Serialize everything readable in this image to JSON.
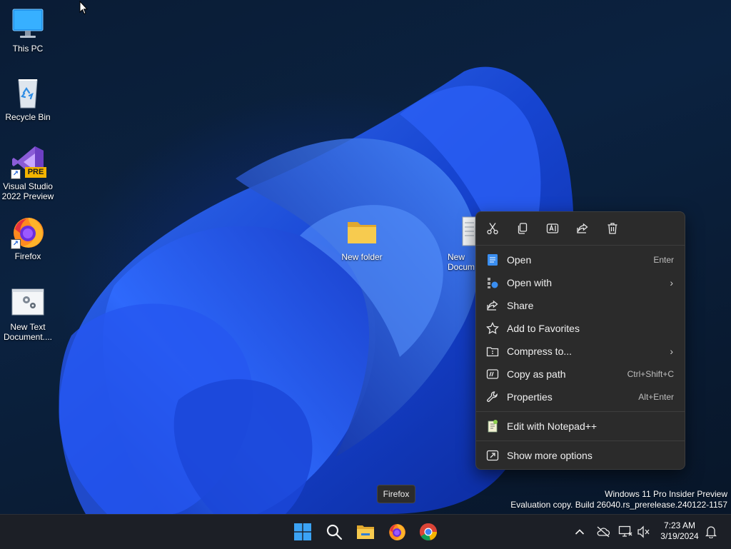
{
  "desktop": {
    "icons": [
      {
        "label": "This PC"
      },
      {
        "label": "Recycle Bin"
      },
      {
        "label": "Visual Studio 2022 Preview",
        "badge": "PRE"
      },
      {
        "label": "Firefox"
      },
      {
        "label": "New Text Document...."
      },
      {
        "label": "New folder"
      },
      {
        "label": "New Docum"
      }
    ]
  },
  "context_menu": {
    "toolbar": [
      {
        "icon": "cut-icon"
      },
      {
        "icon": "copy-icon"
      },
      {
        "icon": "rename-icon"
      },
      {
        "icon": "share-icon"
      },
      {
        "icon": "delete-icon"
      }
    ],
    "items": [
      {
        "label": "Open",
        "shortcut": "Enter",
        "icon": "open-icon"
      },
      {
        "label": "Open with",
        "shortcut": "",
        "icon": "open-with-icon",
        "submenu": true
      },
      {
        "label": "Share",
        "shortcut": "",
        "icon": "share-icon"
      },
      {
        "label": "Add to Favorites",
        "shortcut": "",
        "icon": "star-icon"
      },
      {
        "label": "Compress to...",
        "shortcut": "",
        "icon": "zip-folder-icon",
        "submenu": true
      },
      {
        "label": "Copy as path",
        "shortcut": "Ctrl+Shift+C",
        "icon": "copy-path-icon"
      },
      {
        "label": "Properties",
        "shortcut": "Alt+Enter",
        "icon": "wrench-icon"
      },
      {
        "label": "Edit with Notepad++",
        "shortcut": "",
        "icon": "notepadpp-icon"
      },
      {
        "label": "Show more options",
        "shortcut": "",
        "icon": "more-options-icon"
      }
    ],
    "chevron": "›"
  },
  "tooltip": {
    "text": "Firefox"
  },
  "watermark": {
    "line1": "Windows 11 Pro Insider Preview",
    "line2": "Evaluation copy. Build 26040.rs_prerelease.240122-1157"
  },
  "taskbar": {
    "apps": [
      "start-icon",
      "search-icon",
      "file-explorer-icon",
      "firefox-icon",
      "chrome-icon"
    ],
    "tray": {
      "overflow": "^"
    },
    "clock": {
      "time": "7:23 AM",
      "date": "3/19/2024"
    }
  },
  "colors": {
    "menu_bg": "#2b2b2b",
    "taskbar_bg": "#1c1f26",
    "accent_blue": "#1a6ff0",
    "folder_yellow": "#f7c948"
  }
}
